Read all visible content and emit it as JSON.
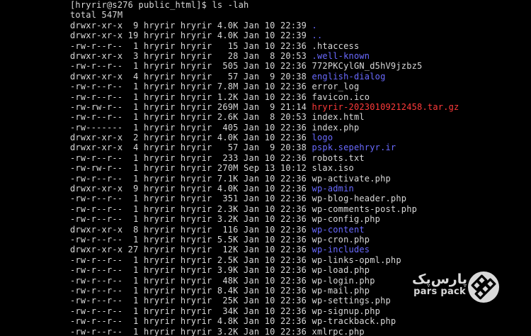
{
  "terminal": {
    "prompt_line": "[hryrir@s276 public_html]$ ls -lah",
    "total_line": "total 547M",
    "entries": [
      {
        "meta": "drwxr-xr-x  9 hryrir hryrir 4.0K Jan 10 22:39 ",
        "name": ".",
        "kind": "dir"
      },
      {
        "meta": "drwxr-xr-x 19 hryrir hryrir 4.0K Jan 10 22:39 ",
        "name": "..",
        "kind": "dir"
      },
      {
        "meta": "-rw-r--r--  1 hryrir hryrir   15 Jan 10 22:36 ",
        "name": ".htaccess",
        "kind": "file"
      },
      {
        "meta": "drwxr-xr-x  3 hryrir hryrir   28 Jan  8 20:53 ",
        "name": ".well-known",
        "kind": "dir"
      },
      {
        "meta": "-rw-r--r--  1 hryrir hryrir  505 Jan 10 22:36 ",
        "name": "772PKCylGN_d5hV9jzbz5",
        "kind": "file"
      },
      {
        "meta": "drwxr-xr-x  4 hryrir hryrir   57 Jan  9 20:38 ",
        "name": "english-dialog",
        "kind": "dir"
      },
      {
        "meta": "-rw-r--r--  1 hryrir hryrir 7.8M Jan 10 22:36 ",
        "name": "error_log",
        "kind": "file"
      },
      {
        "meta": "-rw-r--r--  1 hryrir hryrir 1.2K Jan 10 22:36 ",
        "name": "favicon.ico",
        "kind": "file"
      },
      {
        "meta": "-rw-rw-r--  1 hryrir hryrir 269M Jan  9 21:14 ",
        "name": "hryrir-20230109212458.tar.gz",
        "kind": "archive"
      },
      {
        "meta": "-rw-r--r--  1 hryrir hryrir 2.6K Jan  8 20:53 ",
        "name": "index.html",
        "kind": "file"
      },
      {
        "meta": "-rw-------  1 hryrir hryrir  405 Jan 10 22:36 ",
        "name": "index.php",
        "kind": "file"
      },
      {
        "meta": "drwxr-xr-x  2 hryrir hryrir 4.0K Jan 10 22:36 ",
        "name": "logo",
        "kind": "dir"
      },
      {
        "meta": "drwxr-xr-x  4 hryrir hryrir   57 Jan  9 20:38 ",
        "name": "pspk.sepehryr.ir",
        "kind": "dir"
      },
      {
        "meta": "-rw-r--r--  1 hryrir hryrir  233 Jan 10 22:36 ",
        "name": "robots.txt",
        "kind": "file"
      },
      {
        "meta": "-rw-rw-r--  1 hryrir hryrir 270M Sep 13 10:12 ",
        "name": "slax.iso",
        "kind": "file"
      },
      {
        "meta": "-rw-r--r--  1 hryrir hryrir 7.1K Jan 10 22:36 ",
        "name": "wp-activate.php",
        "kind": "file"
      },
      {
        "meta": "drwxr-xr-x  9 hryrir hryrir 4.0K Jan 10 22:36 ",
        "name": "wp-admin",
        "kind": "dir"
      },
      {
        "meta": "-rw-r--r--  1 hryrir hryrir  351 Jan 10 22:36 ",
        "name": "wp-blog-header.php",
        "kind": "file"
      },
      {
        "meta": "-rw-r--r--  1 hryrir hryrir 2.3K Jan 10 22:36 ",
        "name": "wp-comments-post.php",
        "kind": "file"
      },
      {
        "meta": "-rw-r--r--  1 hryrir hryrir 3.2K Jan 10 22:36 ",
        "name": "wp-config.php",
        "kind": "file"
      },
      {
        "meta": "drwxr-xr-x  8 hryrir hryrir  116 Jan 10 22:36 ",
        "name": "wp-content",
        "kind": "dir"
      },
      {
        "meta": "-rw-r--r--  1 hryrir hryrir 5.5K Jan 10 22:36 ",
        "name": "wp-cron.php",
        "kind": "file"
      },
      {
        "meta": "drwxr-xr-x 27 hryrir hryrir  12K Jan 10 22:36 ",
        "name": "wp-includes",
        "kind": "dir"
      },
      {
        "meta": "-rw-r--r--  1 hryrir hryrir 2.5K Jan 10 22:36 ",
        "name": "wp-links-opml.php",
        "kind": "file"
      },
      {
        "meta": "-rw-r--r--  1 hryrir hryrir 3.9K Jan 10 22:36 ",
        "name": "wp-load.php",
        "kind": "file"
      },
      {
        "meta": "-rw-r--r--  1 hryrir hryrir  48K Jan 10 22:36 ",
        "name": "wp-login.php",
        "kind": "file"
      },
      {
        "meta": "-rw-r--r--  1 hryrir hryrir 8.4K Jan 10 22:36 ",
        "name": "wp-mail.php",
        "kind": "file"
      },
      {
        "meta": "-rw-r--r--  1 hryrir hryrir  25K Jan 10 22:36 ",
        "name": "wp-settings.php",
        "kind": "file"
      },
      {
        "meta": "-rw-r--r--  1 hryrir hryrir  34K Jan 10 22:36 ",
        "name": "wp-signup.php",
        "kind": "file"
      },
      {
        "meta": "-rw-r--r--  1 hryrir hryrir 4.8K Jan 10 22:36 ",
        "name": "wp-trackback.php",
        "kind": "file"
      },
      {
        "meta": "-rw-r--r--  1 hryrir hryrir 3.2K Jan 10 22:36 ",
        "name": "xmlrpc.php",
        "kind": "file"
      }
    ]
  },
  "colors": {
    "background": "#000000",
    "text": "#d8d8d8",
    "directory": "#6a6aff",
    "archive": "#ff3a3a",
    "watermark": "#d9d9d9"
  },
  "watermark": {
    "text_fa": "پارس‌پک",
    "text_en": "pars pack",
    "icon": "parspack-logo-icon"
  }
}
